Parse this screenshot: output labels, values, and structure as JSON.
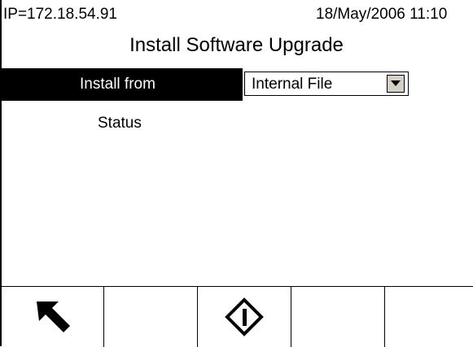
{
  "status_bar": {
    "ip": "IP=172.18.54.91",
    "datetime": "18/May/2006 11:10"
  },
  "page": {
    "title": "Install Software Upgrade"
  },
  "form": {
    "install_from_label": "Install from",
    "install_from_value": "Internal File",
    "status_label": "Status"
  },
  "softkeys": [
    {
      "icon": "exit-arrow-icon"
    },
    {
      "icon": ""
    },
    {
      "icon": "start-diamond-icon"
    },
    {
      "icon": ""
    },
    {
      "icon": ""
    }
  ],
  "colors": {
    "highlight_bar": "#000000",
    "highlight_text": "#ffffff",
    "background": "#ffffff",
    "dropdown_button": "#d4d0c8"
  }
}
